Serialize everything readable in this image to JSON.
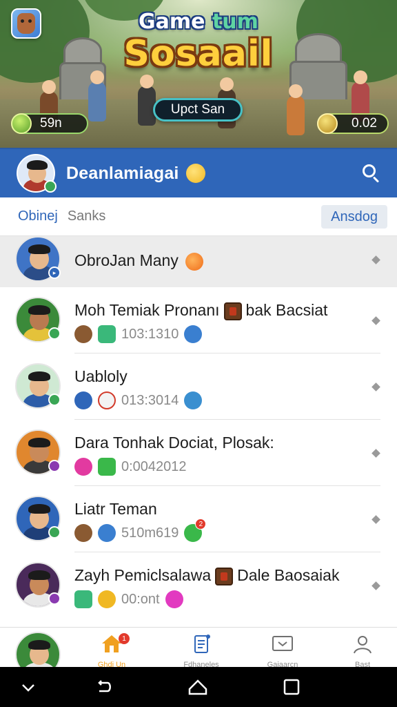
{
  "banner": {
    "title_top_part1": "Game ",
    "title_top_part2": "tum",
    "title_main": "Sosaail",
    "update_button": "Upct San",
    "stat_left": "59n",
    "stat_right": "0.02",
    "icons": [
      "app-avatar-icon",
      "green-gem-icon",
      "gold-coin-icon"
    ]
  },
  "header": {
    "title": "Deanlamiagai",
    "emoji": "grinning-emoji"
  },
  "tabs": {
    "active": "Obinej",
    "second": "Sanks",
    "action": "Ansdog"
  },
  "chats": [
    {
      "name": "ObroJan Many",
      "name_suffix": "",
      "sub": ""
    },
    {
      "name": "Moh Temiak Pronanı",
      "name_suffix": "bak Bacsiat",
      "sub": "103:1310"
    },
    {
      "name": "Uablоly",
      "name_suffix": "",
      "sub": "013:3014"
    },
    {
      "name": "Dara Tonhak Dociat, Plosak:",
      "name_suffix": "",
      "sub": "0:0042012"
    },
    {
      "name": "Liatr Teman",
      "name_suffix": "",
      "sub": "510m619",
      "notification": "2"
    },
    {
      "name": "Zayh Pemiclsalawa",
      "name_suffix": "Dale Baosaiak",
      "sub": "00:ont"
    }
  ],
  "bottom_nav": {
    "items": [
      "Ghdi Un",
      "Fdhaneles",
      "Gaiaarcn",
      "Bast"
    ],
    "home_badge": "1"
  },
  "colors": {
    "header_blue": "#2f66b9",
    "highlight_row": "#ececec",
    "accent_orange": "#f0a020"
  }
}
